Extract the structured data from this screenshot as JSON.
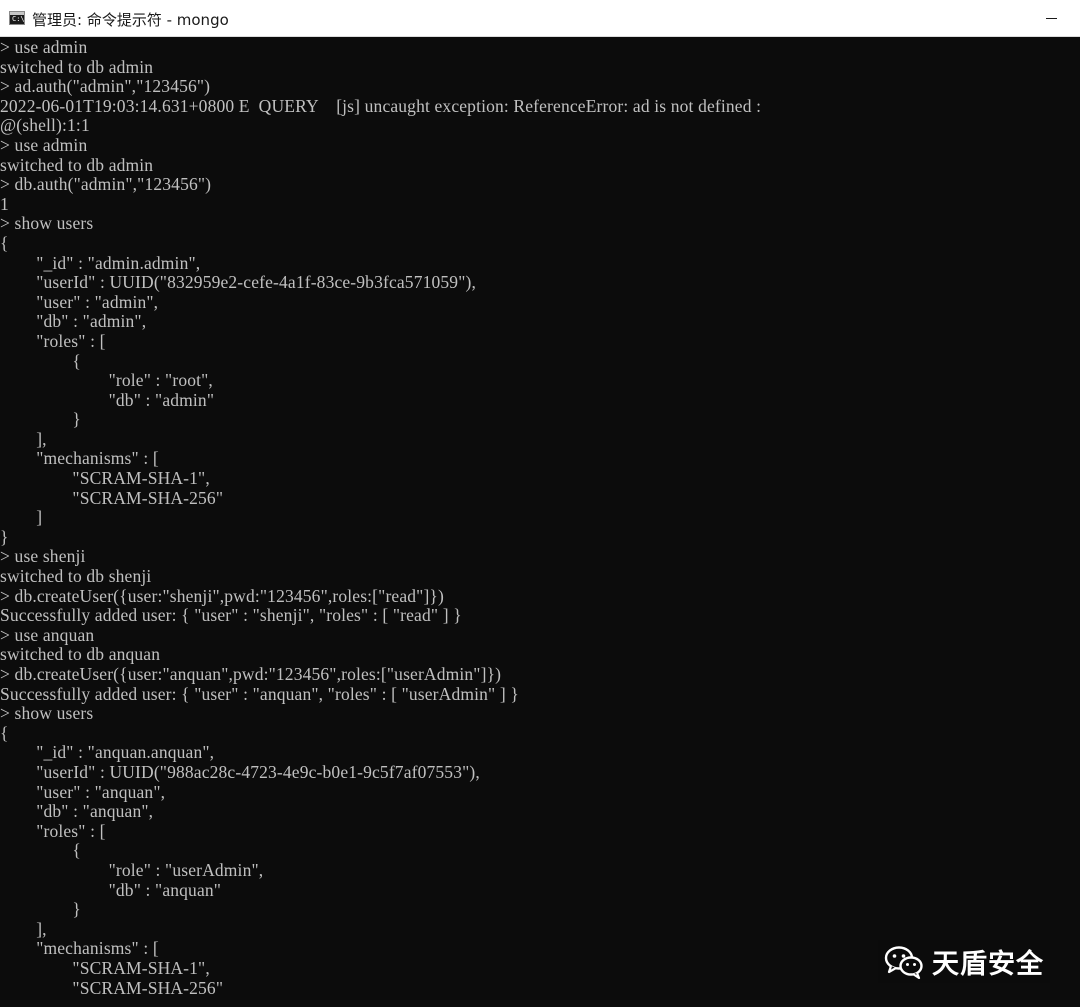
{
  "window": {
    "title": "管理员: 命令提示符 - mongo",
    "icon": "cmd-console-icon",
    "icon_text": "C:\\."
  },
  "console": {
    "lines": [
      "> use admin",
      "switched to db admin",
      "> ad.auth(\"admin\",\"123456\")",
      "2022-06-01T19:03:14.631+0800 E  QUERY    [js] uncaught exception: ReferenceError: ad is not defined :",
      "@(shell):1:1",
      "> use admin",
      "switched to db admin",
      "> db.auth(\"admin\",\"123456\")",
      "1",
      "> show users",
      "{",
      "        \"_id\" : \"admin.admin\",",
      "        \"userId\" : UUID(\"832959e2-cefe-4a1f-83ce-9b3fca571059\"),",
      "        \"user\" : \"admin\",",
      "        \"db\" : \"admin\",",
      "        \"roles\" : [",
      "                {",
      "                        \"role\" : \"root\",",
      "                        \"db\" : \"admin\"",
      "                }",
      "        ],",
      "        \"mechanisms\" : [",
      "                \"SCRAM-SHA-1\",",
      "                \"SCRAM-SHA-256\"",
      "        ]",
      "}",
      "> use shenji",
      "switched to db shenji",
      "> db.createUser({user:\"shenji\",pwd:\"123456\",roles:[\"read\"]})",
      "Successfully added user: { \"user\" : \"shenji\", \"roles\" : [ \"read\" ] }",
      "> use anquan",
      "switched to db anquan",
      "> db.createUser({user:\"anquan\",pwd:\"123456\",roles:[\"userAdmin\"]})",
      "Successfully added user: { \"user\" : \"anquan\", \"roles\" : [ \"userAdmin\" ] }",
      "> show users",
      "{",
      "        \"_id\" : \"anquan.anquan\",",
      "        \"userId\" : UUID(\"988ac28c-4723-4e9c-b0e1-9c5f7af07553\"),",
      "        \"user\" : \"anquan\",",
      "        \"db\" : \"anquan\",",
      "        \"roles\" : [",
      "                {",
      "                        \"role\" : \"userAdmin\",",
      "                        \"db\" : \"anquan\"",
      "                }",
      "        ],",
      "        \"mechanisms\" : [",
      "                \"SCRAM-SHA-1\",",
      "                \"SCRAM-SHA-256\""
    ]
  },
  "watermark": {
    "icon": "wechat-icon",
    "text": "天盾安全"
  },
  "colors": {
    "console_bg": "#0c0c0c",
    "console_text": "#c0c0c0",
    "titlebar_bg": "#ffffff"
  }
}
